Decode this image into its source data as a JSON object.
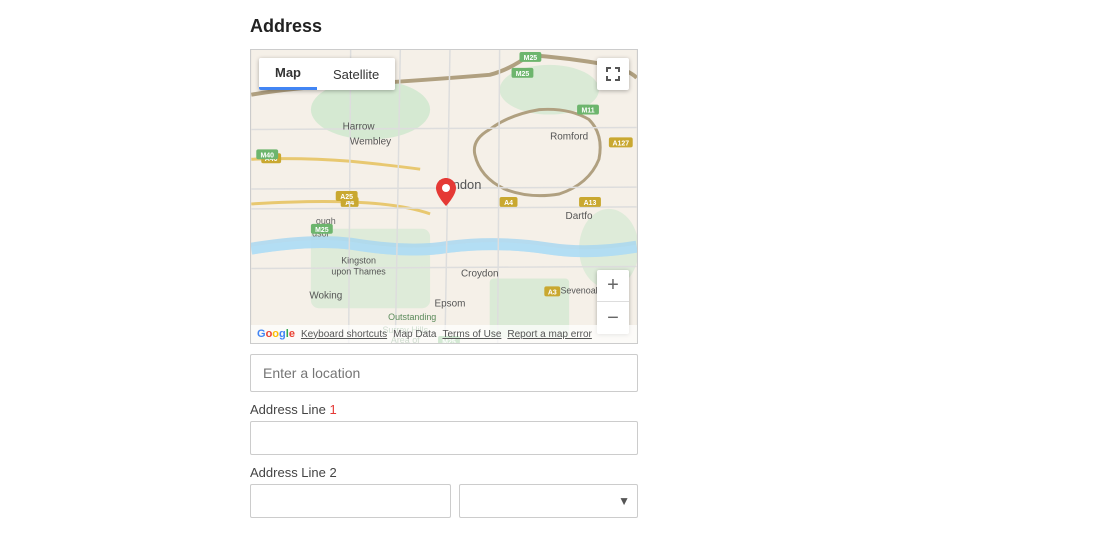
{
  "section": {
    "title": "Address"
  },
  "map": {
    "tab_map": "Map",
    "tab_satellite": "Satellite",
    "active_tab": "map",
    "zoom_in": "+",
    "zoom_out": "−",
    "footer": {
      "keyboard_shortcuts": "Keyboard shortcuts",
      "map_data": "Map Data",
      "terms": "Terms of Use",
      "report": "Report a map error"
    },
    "fullscreen_icon": "⛶"
  },
  "form": {
    "location_placeholder": "Enter a location",
    "address_line1_label": "Address Line 1",
    "address_line1_required": "1",
    "address_line1_value": "",
    "address_line2_label": "Address Line 2",
    "address_line2_value": "",
    "address_line2_dropdown_value": ""
  }
}
